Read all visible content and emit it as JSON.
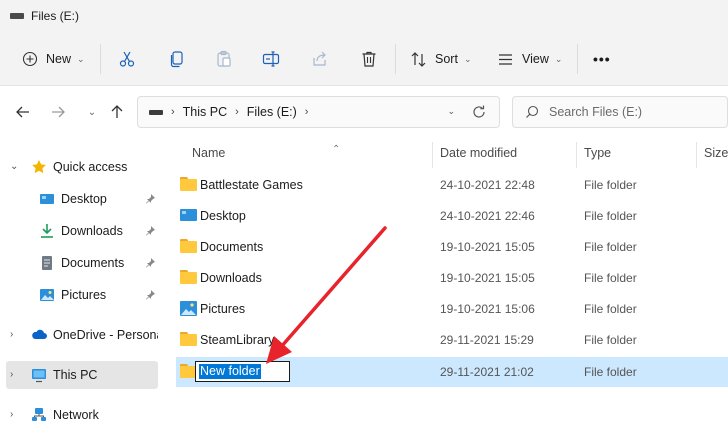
{
  "window": {
    "title": "Files (E:)"
  },
  "toolbar": {
    "new_label": "New",
    "sort_label": "Sort",
    "view_label": "View",
    "more_label": "•••",
    "icons": [
      "cut-icon",
      "copy-icon",
      "paste-icon",
      "rename-icon",
      "share-icon",
      "delete-icon"
    ]
  },
  "address": {
    "crumbs": [
      "This PC",
      "Files (E:)"
    ],
    "search_placeholder": "Search Files (E:)"
  },
  "sidebar": {
    "quick_access": "Quick access",
    "items": [
      {
        "label": "Desktop",
        "icon": "desktop-icon",
        "pinned": true
      },
      {
        "label": "Downloads",
        "icon": "downloads-icon",
        "pinned": true
      },
      {
        "label": "Documents",
        "icon": "documents-icon",
        "pinned": true
      },
      {
        "label": "Pictures",
        "icon": "pictures-icon",
        "pinned": true
      }
    ],
    "onedrive": "OneDrive - Personal",
    "this_pc": "This PC",
    "network": "Network"
  },
  "columns": {
    "name": "Name",
    "date": "Date modified",
    "type": "Type",
    "size": "Size"
  },
  "files": [
    {
      "name": "Battlestate Games",
      "date": "24-10-2021 22:48",
      "type": "File folder",
      "icon": "folder-icon"
    },
    {
      "name": "Desktop",
      "date": "24-10-2021 22:46",
      "type": "File folder",
      "icon": "desktop-folder-icon"
    },
    {
      "name": "Documents",
      "date": "19-10-2021 15:05",
      "type": "File folder",
      "icon": "folder-icon"
    },
    {
      "name": "Downloads",
      "date": "19-10-2021 15:05",
      "type": "File folder",
      "icon": "folder-icon"
    },
    {
      "name": "Pictures",
      "date": "19-10-2021 15:06",
      "type": "File folder",
      "icon": "pictures-folder-icon"
    },
    {
      "name": "SteamLibrary",
      "date": "29-11-2021 15:29",
      "type": "File folder",
      "icon": "folder-icon"
    },
    {
      "name": "New folder",
      "date": "29-11-2021 21:02",
      "type": "File folder",
      "icon": "folder-icon",
      "renaming": true
    }
  ],
  "colors": {
    "accent": "#0078d7",
    "selection": "#cce8ff",
    "arrow": "#e8232b",
    "folder": "#ffc83d"
  }
}
